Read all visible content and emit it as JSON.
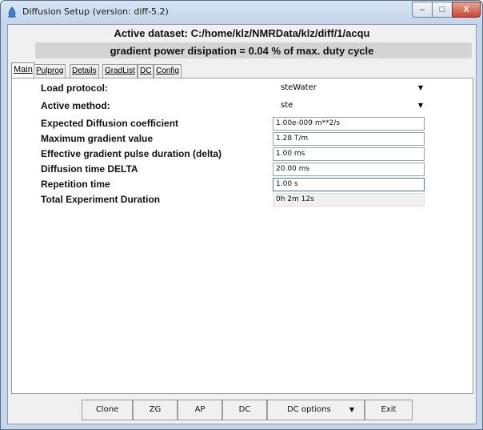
{
  "window": {
    "title": "Diffusion Setup (version: diff-5.2)",
    "controls": {
      "minimize": "–",
      "maximize": "□",
      "close": "X"
    }
  },
  "header": {
    "dataset": "Active dataset: C:/home/klz/NMRData/klz/diff/1/acqu",
    "power": "gradient power disipation = 0.04 % of max. duty cycle"
  },
  "tabs": [
    {
      "label": "Main",
      "active": true
    },
    {
      "label": "Pulprog"
    },
    {
      "label": "Details"
    },
    {
      "label": "GradList"
    },
    {
      "label": "DC"
    },
    {
      "label": "Config"
    }
  ],
  "form": {
    "load_protocol": {
      "label": "Load protocol:",
      "value": "steWater"
    },
    "active_method": {
      "label": "Active method:",
      "value": "ste"
    },
    "diffusion_coeff": {
      "label": "Expected Diffusion coefficient",
      "value": "1.00e-009 m**2/s"
    },
    "max_gradient": {
      "label": "Maximum gradient value",
      "value": "1.28 T/m"
    },
    "pulse_duration": {
      "label": "Effective gradient pulse duration (delta)",
      "value": "1.00 ms"
    },
    "diffusion_time": {
      "label": "Diffusion time DELTA",
      "value": "20.00 ms"
    },
    "repetition_time": {
      "label": "Repetition time",
      "value": "1.00 s"
    },
    "total_duration": {
      "label": "Total Experiment Duration",
      "value": "0h 2m 12s"
    }
  },
  "buttons": {
    "clone": "Clone",
    "zg": "ZG",
    "ap": "AP",
    "dc": "DC",
    "dc_options": "DC options",
    "exit": "Exit"
  }
}
